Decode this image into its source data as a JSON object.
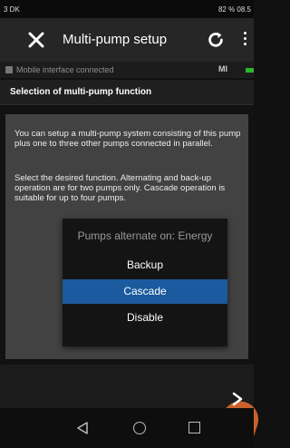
{
  "status_bar": {
    "left": "3 DK",
    "right": "82 % 08.5"
  },
  "app_bar": {
    "title": "Multi-pump setup"
  },
  "connection": {
    "text": "Mobile interface connected",
    "device_code": "MI"
  },
  "section": {
    "title": "Selection of multi-pump function"
  },
  "content": {
    "paragraph_1": "You can setup a multi-pump system consisting of this pump plus one to three other pumps connected in parallel.",
    "paragraph_2": "Select the desired function. Alternating and back-up operation are for two pumps only. Cascade operation is suitable for up to four pumps."
  },
  "dialog": {
    "title": "Pumps alternate on: Energy",
    "options": [
      "Backup",
      "Cascade",
      "Disable"
    ],
    "selected": "Cascade"
  },
  "colors": {
    "selected": "#1b5a9e",
    "card": "#424242",
    "app_bar": "#262626"
  },
  "icons": {
    "close": "close-icon",
    "refresh": "refresh-icon",
    "more": "more-vertical-icon",
    "next": "chevron-right-icon"
  }
}
